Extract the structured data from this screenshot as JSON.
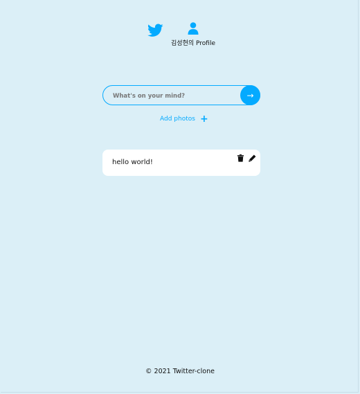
{
  "nav": {
    "home_icon": "twitter-bird-icon",
    "profile_icon": "user-icon",
    "profile_label": "김성현의 Profile",
    "accent_color": "#04aaff"
  },
  "composer": {
    "placeholder": "What's on your mind?",
    "value": "",
    "submit_icon": "→"
  },
  "add_photos": {
    "label": "Add photos",
    "icon": "+"
  },
  "tweets": [
    {
      "text": "hello world!",
      "delete_icon": "trash-icon",
      "edit_icon": "pencil-icon"
    }
  ],
  "footer": {
    "text": "© 2021 Twitter-clone"
  },
  "colors": {
    "background": "#dbeff7",
    "accent": "#04aaff",
    "card": "#ffffff"
  }
}
